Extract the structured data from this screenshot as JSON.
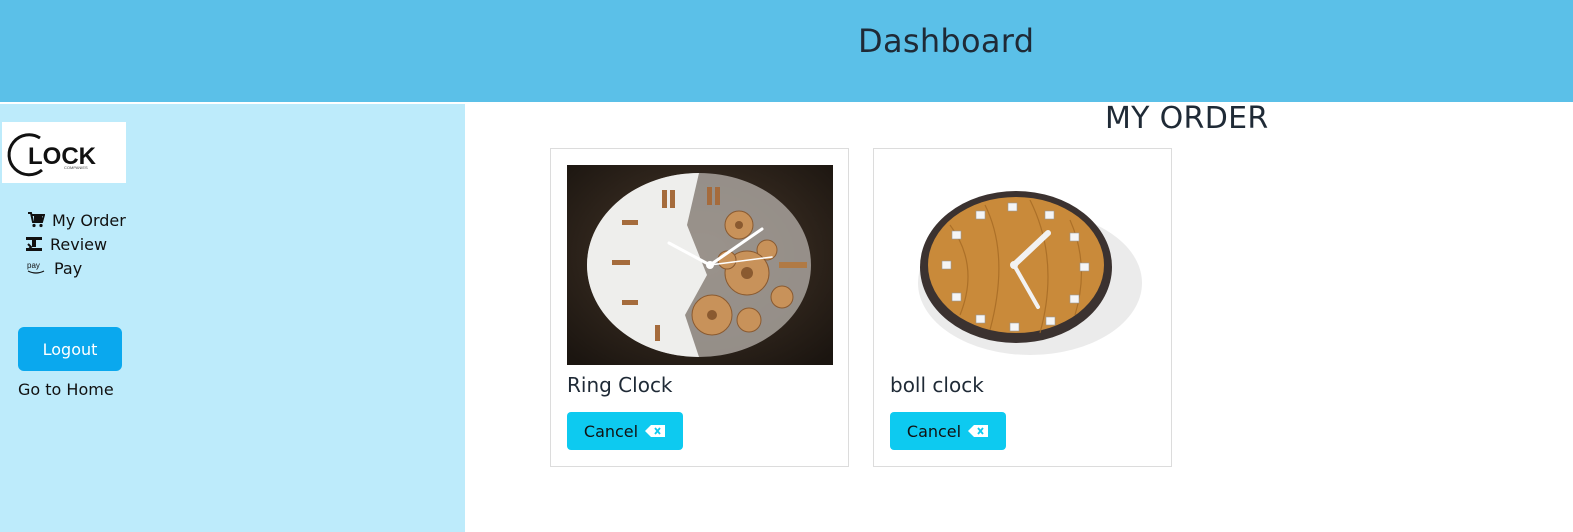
{
  "header": {
    "title": "Dashboard"
  },
  "logo": {
    "text": "LOCK",
    "subtext": "COMPANIES"
  },
  "sidebar": {
    "items": [
      {
        "label": "My Order",
        "icon": "cart-icon"
      },
      {
        "label": "Review",
        "icon": "review-icon"
      },
      {
        "label": "Pay",
        "icon": "amazon-pay-icon",
        "icon_text": "pay"
      }
    ],
    "logout_label": "Logout",
    "home_label": "Go to Home"
  },
  "main": {
    "title": "MY ORDER",
    "orders": [
      {
        "name": "Ring Clock",
        "cancel_label": "Cancel",
        "image": "ring-clock-image"
      },
      {
        "name": "boll clock",
        "cancel_label": "Cancel",
        "image": "boll-clock-image"
      }
    ]
  },
  "colors": {
    "header_bg": "#5bc0e8",
    "sidebar_bg": "#bdebfb",
    "logout_bg": "#0aa8ee",
    "cancel_bg": "#0dcaf0"
  }
}
